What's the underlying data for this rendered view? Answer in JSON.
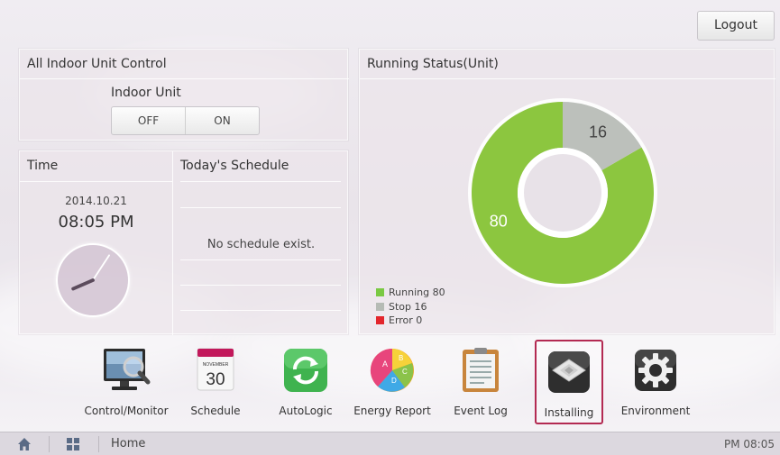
{
  "header": {
    "logout_label": "Logout"
  },
  "indoor_control": {
    "title": "All Indoor Unit Control",
    "unit_label": "Indoor Unit",
    "off_label": "OFF",
    "on_label": "ON"
  },
  "time_panel": {
    "title": "Time",
    "date": "2014.10.21",
    "time": "08:05 PM"
  },
  "schedule_panel": {
    "title": "Today's Schedule",
    "empty_text": "No schedule exist."
  },
  "running_status": {
    "title": "Running Status(Unit)",
    "running_value": 80,
    "stop_value": 16,
    "error_value": 0,
    "running_label_text": "80",
    "stop_label_text": "16",
    "legend": [
      {
        "label": "Running 80",
        "color": "#7ac943"
      },
      {
        "label": "Stop 16",
        "color": "#b6bbb5"
      },
      {
        "label": "Error 0",
        "color": "#e3262c"
      }
    ],
    "colors": {
      "running": "#8cc63f",
      "stop": "#bcc0bb",
      "error": "#e3262c"
    }
  },
  "apps": [
    {
      "label": "Control/Monitor",
      "icon": "monitor-magnifier-icon"
    },
    {
      "label": "Schedule",
      "icon": "calendar-icon",
      "calendar_month": "NOVEMBER",
      "calendar_day": "30"
    },
    {
      "label": "AutoLogic",
      "icon": "autologic-cycle-icon"
    },
    {
      "label": "Energy Report",
      "icon": "energy-report-icon",
      "letters": [
        "A",
        "B",
        "C",
        "D"
      ]
    },
    {
      "label": "Event Log",
      "icon": "event-log-clipboard-icon"
    },
    {
      "label": "Installing",
      "icon": "ceiling-cassette-icon",
      "selected": true
    },
    {
      "label": "Environment",
      "icon": "gear-icon"
    }
  ],
  "bottombar": {
    "location": "Home",
    "time": "PM 08:05"
  }
}
